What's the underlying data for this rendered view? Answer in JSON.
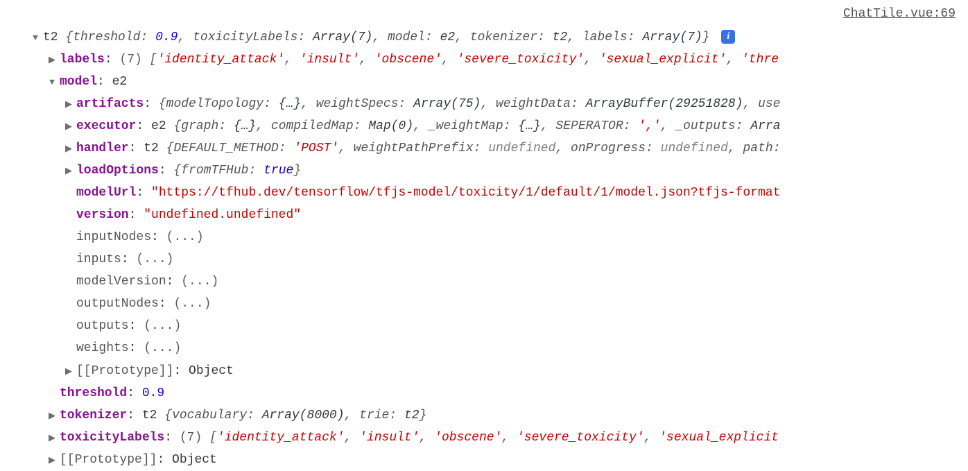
{
  "source": "ChatTile.vue:69",
  "root": {
    "className": "t2",
    "summary": {
      "threshold_k": "threshold:",
      "threshold_v": "0.9",
      "toxicityLabels_k": "toxicityLabels:",
      "toxicityLabels_v": "Array(7)",
      "model_k": "model:",
      "model_v": "e2",
      "tokenizer_k": "tokenizer:",
      "tokenizer_v": "t2",
      "labels_k": "labels:",
      "labels_v": "Array(7)"
    }
  },
  "labels": {
    "key": "labels",
    "count": "(7)",
    "items": [
      "'identity_attack'",
      "'insult'",
      "'obscene'",
      "'severe_toxicity'",
      "'sexual_explicit'",
      "'thre"
    ]
  },
  "model": {
    "key": "model",
    "value": "e2"
  },
  "artifacts": {
    "key": "artifacts",
    "parts": {
      "p1k": "modelTopology:",
      "p1v": "{…}",
      "p2k": "weightSpecs:",
      "p2v": "Array(75)",
      "p3k": "weightData:",
      "p3v": "ArrayBuffer(29251828)",
      "p4k": "use"
    }
  },
  "executor": {
    "key": "executor",
    "cls": "e2",
    "parts": {
      "p1k": "graph:",
      "p1v": "{…}",
      "p2k": "compiledMap:",
      "p2v": "Map(0)",
      "p3k": "_weightMap:",
      "p3v": "{…}",
      "p4k": "SEPERATOR:",
      "p4v": "','",
      "p5k": "_outputs:",
      "p5v": "Arra"
    }
  },
  "handler": {
    "key": "handler",
    "cls": "t2",
    "parts": {
      "p1k": "DEFAULT_METHOD:",
      "p1v": "'POST'",
      "p2k": "weightPathPrefix:",
      "p2v": "undefined",
      "p3k": "onProgress:",
      "p3v": "undefined",
      "p4k": "path:"
    }
  },
  "loadOptions": {
    "key": "loadOptions",
    "p1k": "fromTFHub:",
    "p1v": "true"
  },
  "modelUrl": {
    "key": "modelUrl",
    "value": "\"https://tfhub.dev/tensorflow/tfjs-model/toxicity/1/default/1/model.json?tfjs-format"
  },
  "version": {
    "key": "version",
    "value": "\"undefined.undefined\""
  },
  "getters": {
    "inputNodes": "inputNodes",
    "inputs": "inputs",
    "modelVersion": "modelVersion",
    "outputNodes": "outputNodes",
    "outputs": "outputs",
    "weights": "weights",
    "ellipsis": "(...)"
  },
  "prototype": {
    "key": "[[Prototype]]",
    "value": "Object"
  },
  "threshold": {
    "key": "threshold",
    "value": "0.9"
  },
  "tokenizer": {
    "key": "tokenizer",
    "cls": "t2",
    "p1k": "vocabulary:",
    "p1v": "Array(8000)",
    "p2k": "trie:",
    "p2v": "t2"
  },
  "toxicityLabels": {
    "key": "toxicityLabels",
    "count": "(7)",
    "items": [
      "'identity_attack'",
      "'insult'",
      "'obscene'",
      "'severe_toxicity'",
      "'sexual_explicit"
    ]
  },
  "info_badge": "i"
}
